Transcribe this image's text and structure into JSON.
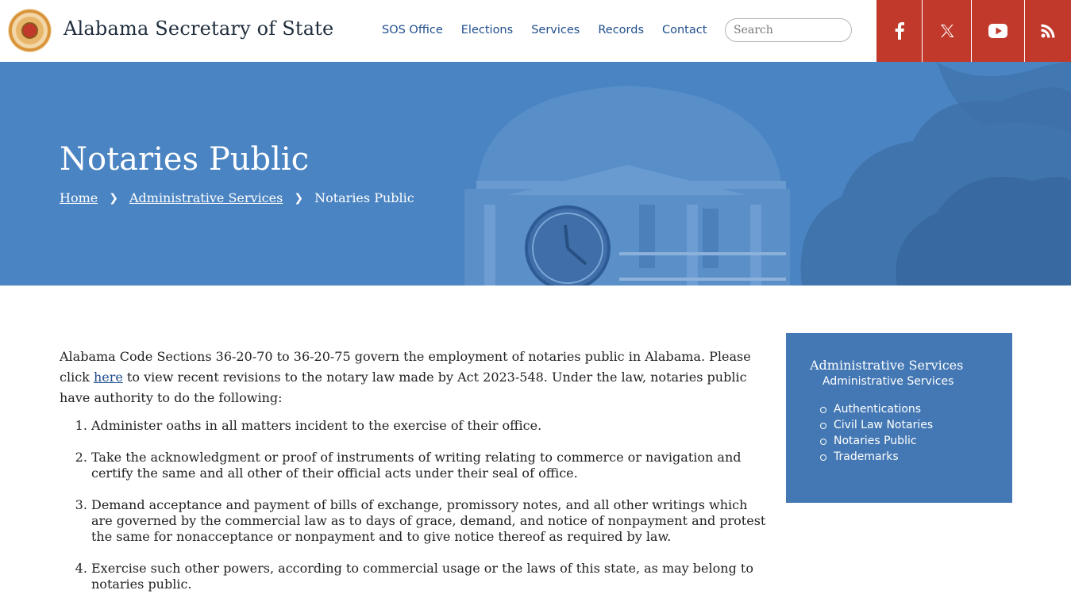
{
  "header": {
    "site_title": "Alabama Secretary of State",
    "logo_icon": "state-seal-icon",
    "nav": [
      "SOS Office",
      "Elections",
      "Services",
      "Records",
      "Contact"
    ],
    "search_placeholder": "Search",
    "social": [
      "facebook-icon",
      "x-icon",
      "youtube-icon",
      "rss-icon"
    ],
    "social_color": "#c1392b"
  },
  "hero": {
    "title": "Notaries Public",
    "breadcrumb": {
      "home": "Home",
      "section": "Administrative Services",
      "current": "Notaries Public"
    },
    "bg_color": "#4a84c2"
  },
  "content": {
    "intro_before_link": "Alabama Code Sections 36-20-70 to 36-20-75 govern the employment of notaries public in Alabama. Please click ",
    "intro_link": "here",
    "intro_after_link": " to view recent revisions to the notary law made by Act 2023-548. Under the law, notaries public have authority to do the following:",
    "items": [
      "Administer oaths in all matters incident to the exercise of their office.",
      "Take the acknowledgment or proof of instruments of writing relating to commerce or navigation and certify the same and all other of their official acts under their seal of office.",
      "Demand acceptance and payment of bills of exchange, promissory notes, and all other writings which are governed by the commercial law as to days of grace, demand, and notice of nonpayment and protest the same for nonacceptance or nonpayment and to give notice thereof as required by law.",
      "Exercise such other powers, according to commercial usage or the laws of this state, as may belong to notaries public."
    ]
  },
  "sidebar": {
    "title": "Administrative Services",
    "subtitle": "Administrative Services",
    "links": [
      "Authentications",
      "Civil Law Notaries",
      "Notaries Public",
      "Trademarks"
    ],
    "bg_color": "#4478b4"
  }
}
